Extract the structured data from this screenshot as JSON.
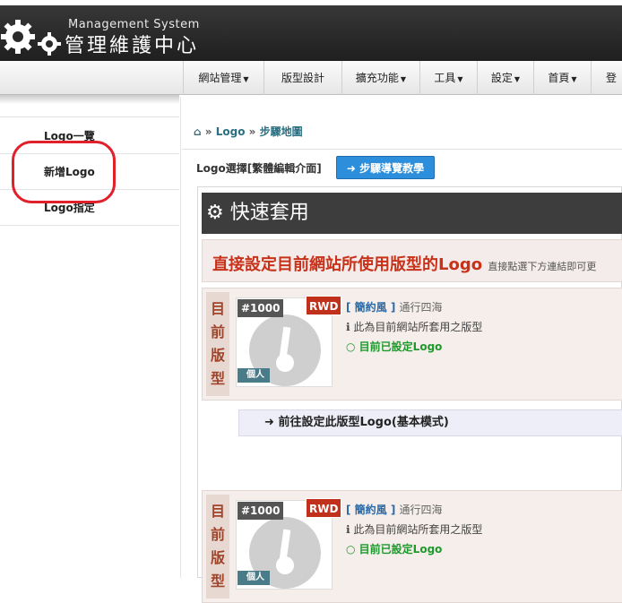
{
  "header": {
    "brand_sub": "Management System",
    "brand_main": "管理維護中心"
  },
  "nav": {
    "items": [
      {
        "label": "網站管理",
        "caret": "▼"
      },
      {
        "label": "版型設計",
        "caret": ""
      },
      {
        "label": "擴充功能",
        "caret": "▼"
      },
      {
        "label": "工具",
        "caret": "▼"
      },
      {
        "label": "設定",
        "caret": "▼"
      },
      {
        "label": "首頁",
        "caret": "▼"
      },
      {
        "label": "登出",
        "caret": ""
      }
    ]
  },
  "sidebar": {
    "items": [
      {
        "label": "Logo一覽"
      },
      {
        "label": "新增Logo"
      },
      {
        "label": "Logo指定"
      }
    ],
    "highlight_color": "#e0202a"
  },
  "breadcrumb": {
    "home_icon": "home-icon",
    "sep1": "»",
    "item1": "Logo",
    "sep2": "»",
    "item2": "步驟地圖"
  },
  "main": {
    "pick_label": "Logo選擇[繁體編輯介面]",
    "guide_button": "步驟導覽教學",
    "panel_title": "快速套用",
    "panel_sub_big": "直接設定目前網站所使用版型的Logo",
    "panel_sub_small": "直接點選下方連結即可更",
    "cards": [
      {
        "tag": "目前版型",
        "num": "#1000",
        "rwd": "RWD",
        "personal": "個人",
        "style_label": "[ 簡約風 ]",
        "style_name": "通行四海",
        "note": "此為目前網站所套用之版型",
        "status": "目前已設定Logo"
      },
      {
        "tag": "目前版型",
        "num": "#1000",
        "rwd": "RWD",
        "personal": "個人",
        "style_label": "[ 簡約風 ]",
        "style_name": "通行四海",
        "note": "此為目前網站所套用之版型",
        "status": "目前已設定Logo"
      }
    ],
    "go_button": "前往設定此版型Logo(基本模式)"
  },
  "colors": {
    "accent": "#2d8fdb",
    "title_red": "#c8321a",
    "status_green": "#1e9a2d"
  }
}
